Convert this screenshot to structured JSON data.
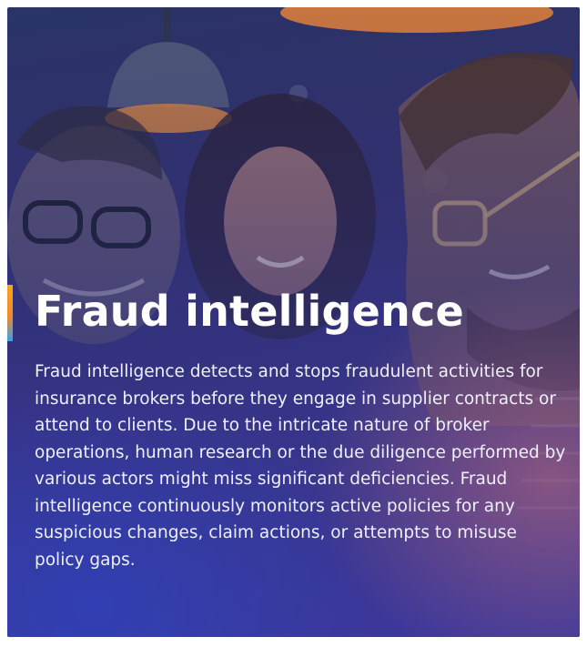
{
  "card": {
    "title": "Fraud intelligence",
    "description": "Fraud intelligence detects and stops fraudulent activities for insurance brokers before they engage in supplier contracts or attend to clients. Due to the intricate nature of broker operations, human research or the due diligence performed by various actors might miss significant deficiencies. Fraud intelligence continuously monitors active policies for any suspicious changes, claim actions, or attempts to misuse policy gaps."
  },
  "colors": {
    "accent_top": "#f5a623",
    "accent_bottom": "#3aa0e8",
    "text": "#ffffff"
  }
}
